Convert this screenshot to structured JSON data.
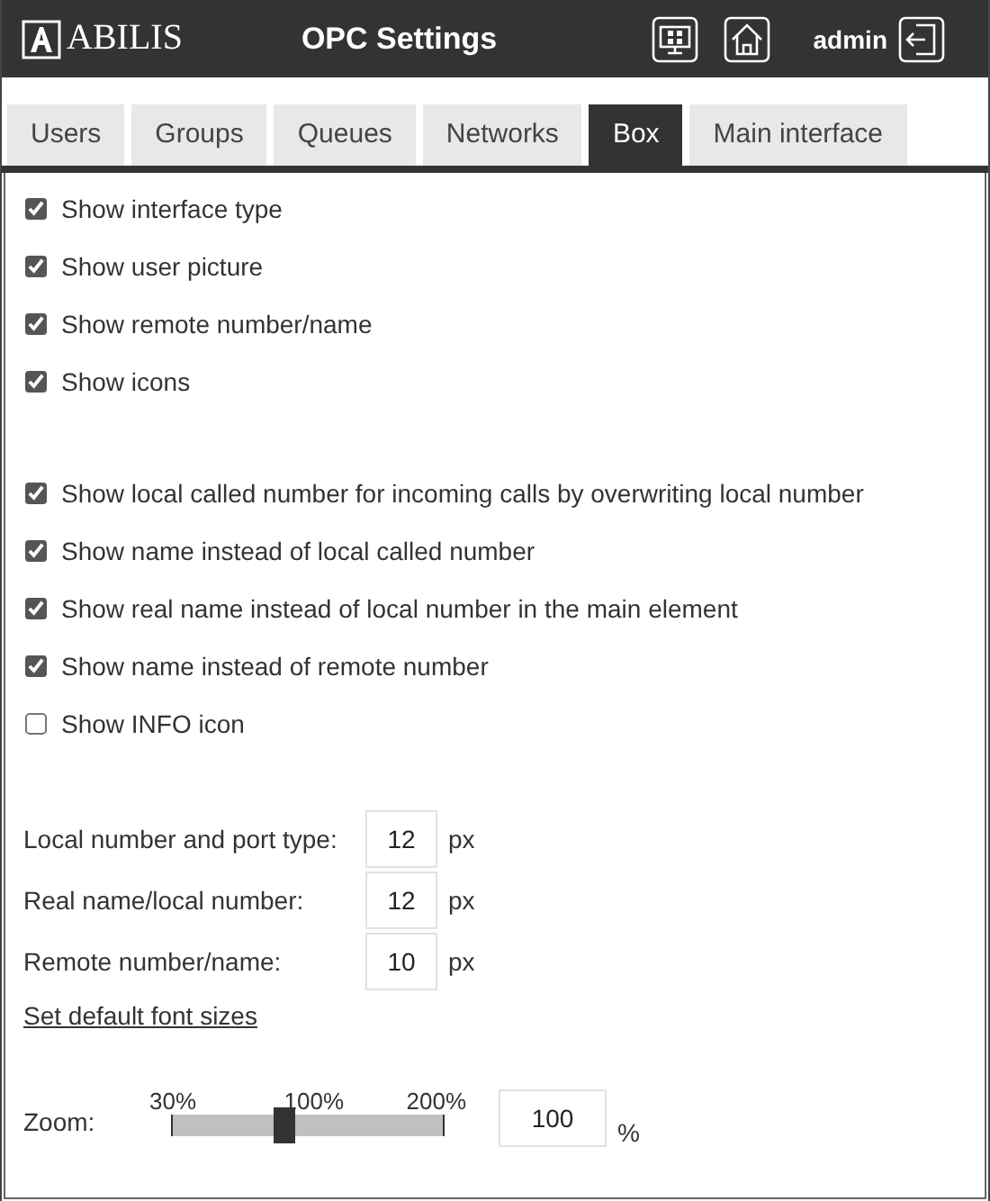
{
  "header": {
    "logo": "ABILIS",
    "title": "OPC Settings",
    "user": "admin"
  },
  "tabs": [
    {
      "label": "Users",
      "selected": false
    },
    {
      "label": "Groups",
      "selected": false
    },
    {
      "label": "Queues",
      "selected": false
    },
    {
      "label": "Networks",
      "selected": false
    },
    {
      "label": "Box",
      "selected": true
    },
    {
      "label": "Main interface",
      "selected": false
    }
  ],
  "option_groups": [
    [
      {
        "label": "Show interface type",
        "checked": true
      },
      {
        "label": "Show user picture",
        "checked": true
      },
      {
        "label": "Show remote number/name",
        "checked": true
      },
      {
        "label": "Show icons",
        "checked": true
      }
    ],
    [
      {
        "label": "Show local called number for incoming calls by overwriting local number",
        "checked": true
      },
      {
        "label": "Show name instead of local called number",
        "checked": true
      },
      {
        "label": "Show real name instead of local number in the main element",
        "checked": true
      },
      {
        "label": "Show name instead of remote number",
        "checked": true
      },
      {
        "label": "Show INFO icon",
        "checked": false
      }
    ]
  ],
  "font_sizes": [
    {
      "label": "Local number and port type:",
      "value": "12",
      "unit": "px"
    },
    {
      "label": "Real name/local number:",
      "value": "12",
      "unit": "px"
    },
    {
      "label": "Remote number/name:",
      "value": "10",
      "unit": "px"
    }
  ],
  "default_link": "Set default font sizes",
  "zoom": {
    "label": "Zoom:",
    "ticks": [
      "30%",
      "100%",
      "200%"
    ],
    "level": 0.41,
    "value": "100",
    "unit": "%"
  }
}
